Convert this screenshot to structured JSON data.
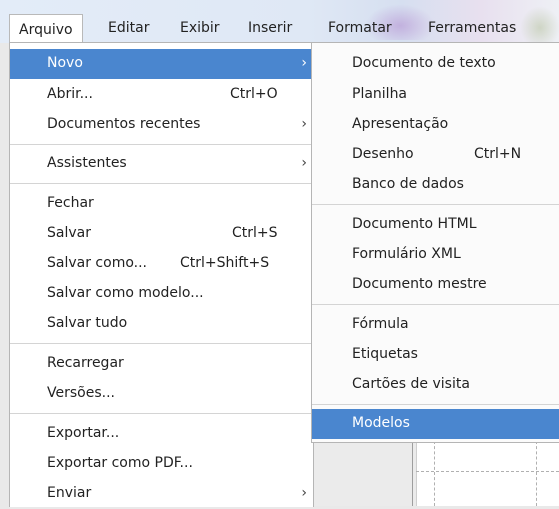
{
  "menubar": {
    "items": [
      {
        "label": "Arquivo",
        "active": true
      },
      {
        "label": "Editar"
      },
      {
        "label": "Exibir"
      },
      {
        "label": "Inserir"
      },
      {
        "label": "Formatar"
      },
      {
        "label": "Ferramentas"
      }
    ]
  },
  "arquivo_menu": {
    "items": [
      {
        "label": "Novo",
        "arrow": "›"
      },
      {
        "label": "Abrir...",
        "shortcut": "Ctrl+O"
      },
      {
        "label": "Documentos recentes",
        "arrow": "›"
      },
      {
        "label": "Assistentes",
        "arrow": "›"
      },
      {
        "label": "Fechar"
      },
      {
        "label": "Salvar",
        "shortcut": "Ctrl+S"
      },
      {
        "label": "Salvar como...",
        "shortcut": "Ctrl+Shift+S"
      },
      {
        "label": "Salvar como modelo..."
      },
      {
        "label": "Salvar tudo"
      },
      {
        "label": "Recarregar"
      },
      {
        "label": "Versões..."
      },
      {
        "label": "Exportar..."
      },
      {
        "label": "Exportar como PDF..."
      },
      {
        "label": "Enviar",
        "arrow": "›"
      }
    ]
  },
  "novo_submenu": {
    "items": [
      {
        "label": "Documento de texto"
      },
      {
        "label": "Planilha"
      },
      {
        "label": "Apresentação"
      },
      {
        "label": "Desenho",
        "shortcut": "Ctrl+N"
      },
      {
        "label": "Banco de dados"
      },
      {
        "label": "Documento HTML"
      },
      {
        "label": "Formulário XML"
      },
      {
        "label": "Documento mestre"
      },
      {
        "label": "Fórmula"
      },
      {
        "label": "Etiquetas"
      },
      {
        "label": "Cartões de visita"
      },
      {
        "label": "Modelos"
      }
    ]
  },
  "colors": {
    "highlight": "#4a86cf",
    "menu_bg": "#ffffff",
    "separator": "#d4d4d4"
  }
}
